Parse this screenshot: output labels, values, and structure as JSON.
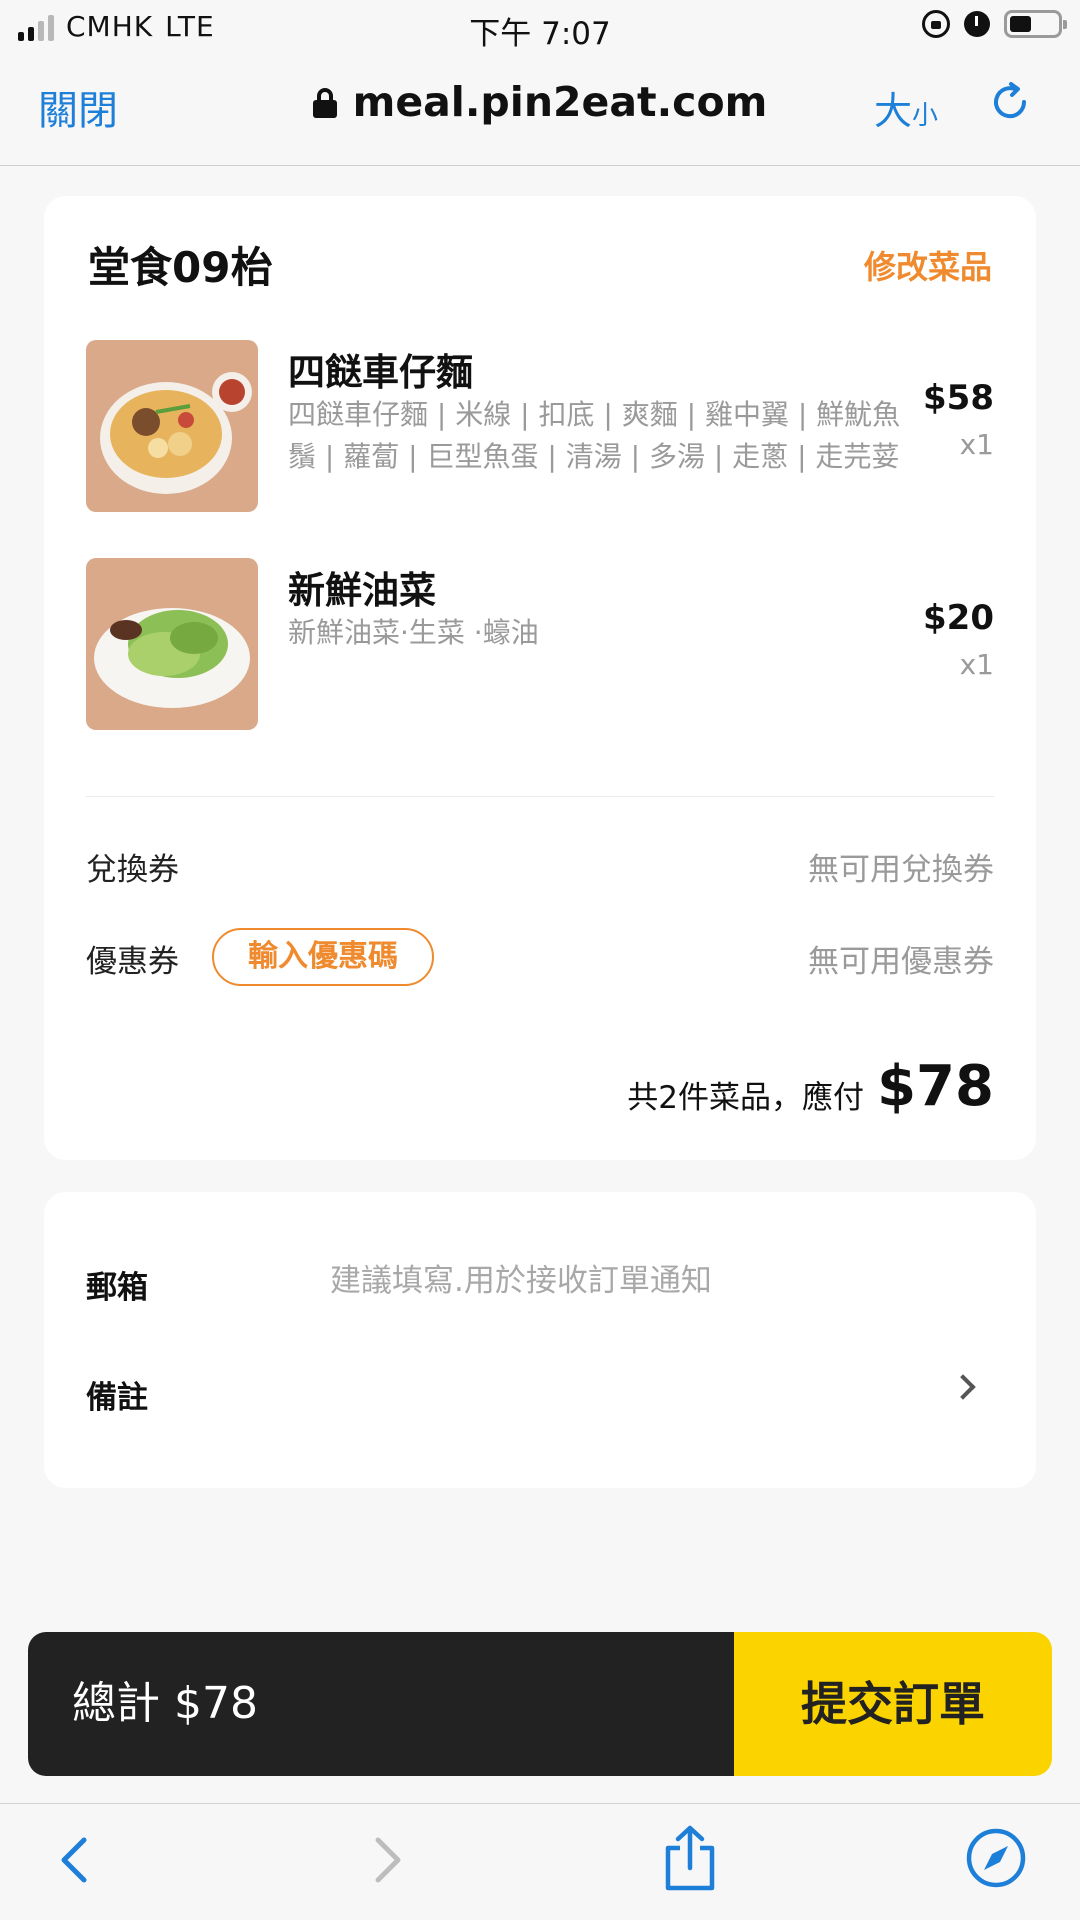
{
  "status_bar": {
    "carrier": "CMHK",
    "network": "LTE",
    "time": "下午 7:07",
    "battery_level": 0.45
  },
  "browser": {
    "close_label": "關閉",
    "url": "meal.pin2eat.com",
    "text_size_big": "大",
    "text_size_small": "小"
  },
  "order": {
    "table_title": "堂食09枱",
    "edit_items_label": "修改菜品",
    "items": [
      {
        "name": "四餸車仔麵",
        "description": "四餸車仔麵 | 米線 | 扣底 | 爽麵 | 雞中翼 | 鮮魷魚鬚 | 蘿蔔 | 巨型魚蛋 | 清湯 | 多湯 | 走蔥 | 走芫荽",
        "price": "$58",
        "quantity": "x1"
      },
      {
        "name": "新鮮油菜",
        "description": "新鮮油菜·生菜 ·蠔油",
        "price": "$20",
        "quantity": "x1"
      }
    ],
    "voucher_label": "兌換券",
    "voucher_value": "無可用兌換券",
    "coupon_label": "優惠券",
    "coupon_button": "輸入優惠碼",
    "coupon_value": "無可用優惠券",
    "summary_text": "共2件菜品，應付",
    "summary_total": "$78"
  },
  "info": {
    "email_label": "郵箱",
    "email_placeholder": "建議填寫.用於接收訂單通知",
    "email_value": "",
    "remarks_label": "備註"
  },
  "checkout": {
    "total_label": "總計 $78",
    "submit_label": "提交訂單"
  },
  "colors": {
    "accent_orange": "#ef8a2e",
    "link_blue": "#1e7fd8",
    "submit_yellow": "#fbd400",
    "checkout_dark": "#222222"
  },
  "icons": {
    "status": [
      "signal-icon",
      "orientation-lock-icon",
      "alarm-icon",
      "battery-icon"
    ],
    "browser": [
      "padlock-icon",
      "reload-icon"
    ],
    "toolbar": [
      "back-icon",
      "forward-icon",
      "share-icon",
      "compass-icon"
    ],
    "rows": [
      "chevron-right-icon"
    ]
  }
}
